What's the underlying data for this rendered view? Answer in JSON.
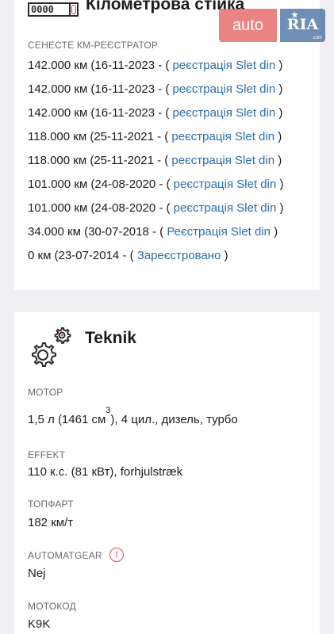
{
  "odometer": {
    "icon_digits": "0000",
    "title": "Кілометрова стійка",
    "section_label": "СЕНЕСТЕ КМ-РЕЄСТРАТОР",
    "entries": [
      {
        "text": "142.000 км (16-11-2023 - ( ",
        "link": "реєстрація Slet din",
        "close": " )"
      },
      {
        "text": "142.000 км (16-11-2023 - ( ",
        "link": "реєстрація Slet din",
        "close": " )"
      },
      {
        "text": "142.000 км (16-11-2023 - ( ",
        "link": "реєстрація Slet din",
        "close": " )"
      },
      {
        "text": "118.000 км (25-11-2021 - ( ",
        "link": "реєстрація Slet din",
        "close": " )"
      },
      {
        "text": "118.000 км (25-11-2021 - ( ",
        "link": "реєстрація Slet din",
        "close": " )"
      },
      {
        "text": "101.000 км (24-08-2020 - ( ",
        "link": "реєстрація Slet din",
        "close": " )"
      },
      {
        "text": "101.000 км (24-08-2020 - ( ",
        "link": "реєстрація Slet din",
        "close": " )"
      },
      {
        "text": "34.000 км (30-07-2018 - ( ",
        "link": "Реєстрація Slet din",
        "close": " )"
      },
      {
        "text": "0 км (23-07-2014 - ( ",
        "link": "Зареєстровано",
        "close": " )"
      }
    ]
  },
  "logo": {
    "auto": "auto",
    "ria": "RIA",
    "domain": ".com"
  },
  "tech": {
    "title": "Teknik",
    "motor_label": "МОТОР",
    "motor_value_a": "1,5 л (1461 см",
    "motor_sup": "3",
    "motor_value_b": "), 4 цил., дизель, турбо",
    "effect_label": "EFFEKT",
    "effect_value": "110 к.с. (81 кВт), forhjulstræk",
    "topfart_label": "ТОПФАРТ",
    "topfart_value": "182 км/т",
    "gear_label": "AUTOMATGEAR",
    "gear_info": "i",
    "gear_value": "Nej",
    "motorcode_label": "МОТОКОД",
    "motorcode_value": "K9K"
  },
  "colors": {
    "link": "#2b6ea8",
    "accent_red": "#d95353",
    "logo_auto_bg": "#e35a5a",
    "logo_ria_bg": "#466ea0"
  }
}
